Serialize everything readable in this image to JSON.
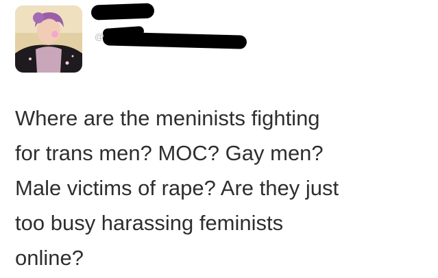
{
  "tweet": {
    "handle_prefix": "@",
    "text_lines": [
      "Where are the meninists fighting",
      "for trans men? MOC? Gay men?",
      "Male victims of rape? Are they just",
      "too busy harassing feminists",
      "online?"
    ]
  },
  "avatar_icon": "profile-photo",
  "colors": {
    "text": "#2e2e2e",
    "redaction": "#000000",
    "handle": "#b8b8b8"
  }
}
